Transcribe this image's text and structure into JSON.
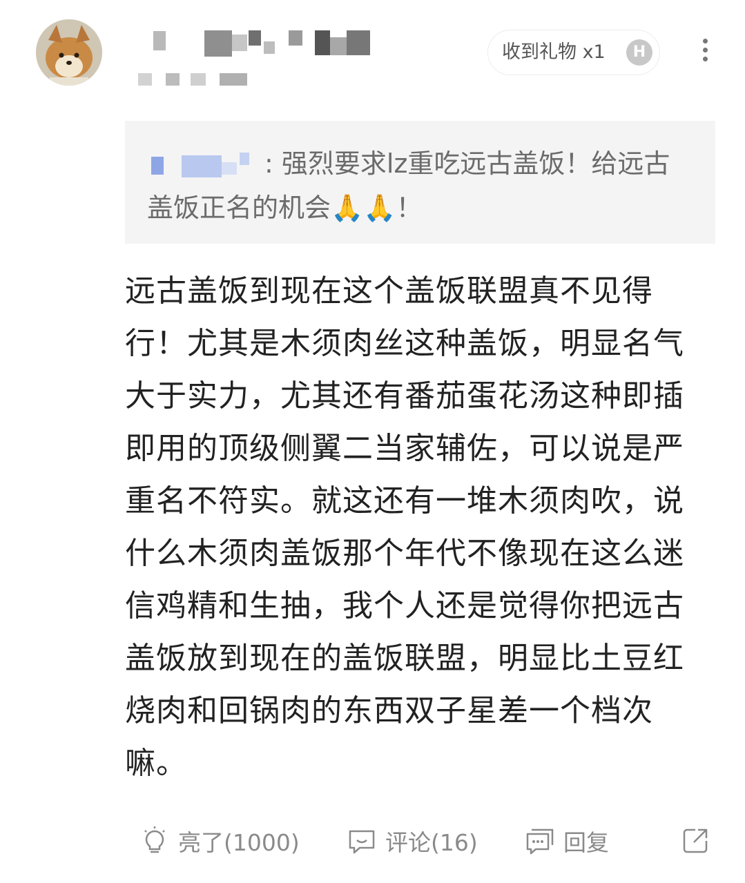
{
  "gift": {
    "label": "收到礼物 x1",
    "badge": "H"
  },
  "quote": {
    "text": ": 强烈要求lz重吃远古盖饭！给远古盖饭正名的机会🙏🙏！"
  },
  "post": {
    "body": "远古盖饭到现在这个盖饭联盟真不见得行！尤其是木须肉丝这种盖饭，明显名气大于实力，尤其还有番茄蛋花汤这种即插即用的顶级侧翼二当家辅佐，可以说是严重名不符实。就这还有一堆木须肉吹，说什么木须肉盖饭那个年代不像现在这么迷信鸡精和生抽，我个人还是觉得你把远古盖饭放到现在的盖饭联盟，明显比土豆红烧肉和回锅肉的东西双子星差一个档次嘛。"
  },
  "actions": {
    "like": "亮了(1000)",
    "comment": "评论(16)",
    "reply": "回复"
  },
  "icons": {
    "like": "lightbulb-icon",
    "comment": "comment-icon",
    "reply": "reply-bubble-icon",
    "share": "share-icon",
    "more": "more-vertical-icon"
  }
}
